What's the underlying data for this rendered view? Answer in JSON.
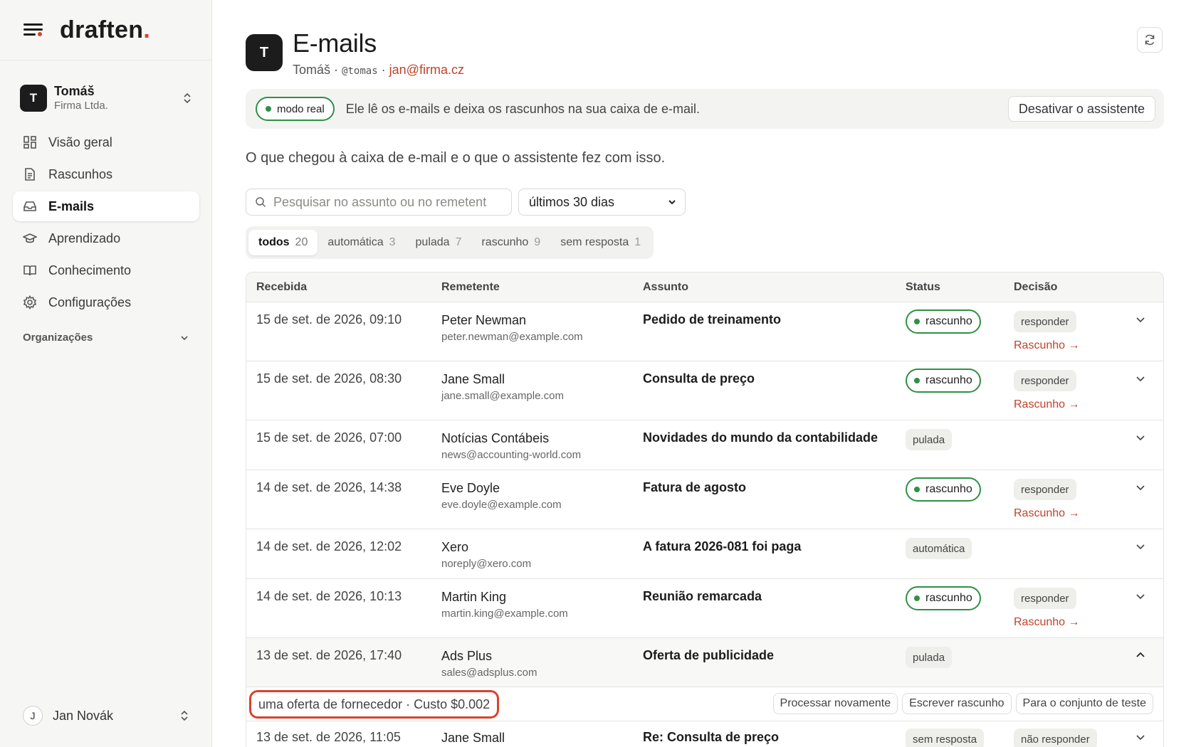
{
  "brand": {
    "logo_text": "draften",
    "logo_dot": "."
  },
  "workspace": {
    "initial": "T",
    "name": "Tomáš",
    "org": "Firma Ltda."
  },
  "nav": [
    {
      "label": "Visão geral",
      "icon": "grid-icon"
    },
    {
      "label": "Rascunhos",
      "icon": "document-icon"
    },
    {
      "label": "E-mails",
      "icon": "inbox-icon",
      "active": true
    },
    {
      "label": "Aprendizado",
      "icon": "graduation-cap-icon"
    },
    {
      "label": "Conhecimento",
      "icon": "book-icon"
    },
    {
      "label": "Configurações",
      "icon": "gear-icon"
    }
  ],
  "organizations_label": "Organizações",
  "user": {
    "initial": "J",
    "name": "Jan Novák"
  },
  "header": {
    "avatar": "T",
    "title": "E-mails",
    "name": "Tomáš",
    "separator": "·",
    "handle": "@tomas",
    "email": "jan@firma.cz"
  },
  "banner": {
    "mode": "modo real",
    "text": "Ele lê os e-mails e deixa os rascunhos na sua caixa de e-mail.",
    "deactivate": "Desativar o assistente"
  },
  "description": "O que chegou à caixa de e-mail e o que o assistente fez com isso.",
  "search": {
    "placeholder": "Pesquisar no assunto ou no remetent"
  },
  "range": {
    "selected": "últimos 30 dias"
  },
  "tabs": [
    {
      "label": "todos",
      "count": "20"
    },
    {
      "label": "automática",
      "count": "3"
    },
    {
      "label": "pulada",
      "count": "7"
    },
    {
      "label": "rascunho",
      "count": "9"
    },
    {
      "label": "sem resposta",
      "count": "1"
    }
  ],
  "columns": {
    "received": "Recebida",
    "sender": "Remetente",
    "subject": "Assunto",
    "status": "Status",
    "decision": "Decisão"
  },
  "rows": [
    {
      "date": "15 de set. de 2026, 09:10",
      "sender": "Peter Newman",
      "email": "peter.newman@example.com",
      "subject": "Pedido de treinamento",
      "status": "rascunho",
      "decision": "responder",
      "link": "Rascunho →"
    },
    {
      "date": "15 de set. de 2026, 08:30",
      "sender": "Jane Small",
      "email": "jane.small@example.com",
      "subject": "Consulta de preço",
      "status": "rascunho",
      "decision": "responder",
      "link": "Rascunho →"
    },
    {
      "date": "15 de set. de 2026, 07:00",
      "sender": "Notícias Contábeis",
      "email": "news@accounting-world.com",
      "subject": "Novidades do mundo da contabilidade",
      "status": "pulada"
    },
    {
      "date": "14 de set. de 2026, 14:38",
      "sender": "Eve Doyle",
      "email": "eve.doyle@example.com",
      "subject": "Fatura de agosto",
      "status": "rascunho",
      "decision": "responder",
      "link": "Rascunho →"
    },
    {
      "date": "14 de set. de 2026, 12:02",
      "sender": "Xero",
      "email": "noreply@xero.com",
      "subject": "A fatura 2026-081 foi paga",
      "status": "automática"
    },
    {
      "date": "14 de set. de 2026, 10:13",
      "sender": "Martin King",
      "email": "martin.king@example.com",
      "subject": "Reunião remarcada",
      "status": "rascunho",
      "decision": "responder",
      "link": "Rascunho →"
    },
    {
      "date": "13 de set. de 2026, 17:40",
      "sender": "Ads Plus",
      "email": "sales@adsplus.com",
      "subject": "Oferta de publicidade",
      "status": "pulada"
    },
    {
      "date": "13 de set. de 2026, 11:05",
      "sender": "Jane Small",
      "email": "",
      "subject": "Re: Consulta de preço",
      "status": "sem resposta",
      "decision": "não responder"
    }
  ],
  "detail": {
    "info": "uma oferta de fornecedor · Custo $0.002",
    "actions": [
      "Processar novamente",
      "Escrever rascunho",
      "Para o conjunto de teste"
    ]
  },
  "colors": {
    "accent": "#d8432b",
    "green": "#2f8f46",
    "link": "#c0432a"
  }
}
